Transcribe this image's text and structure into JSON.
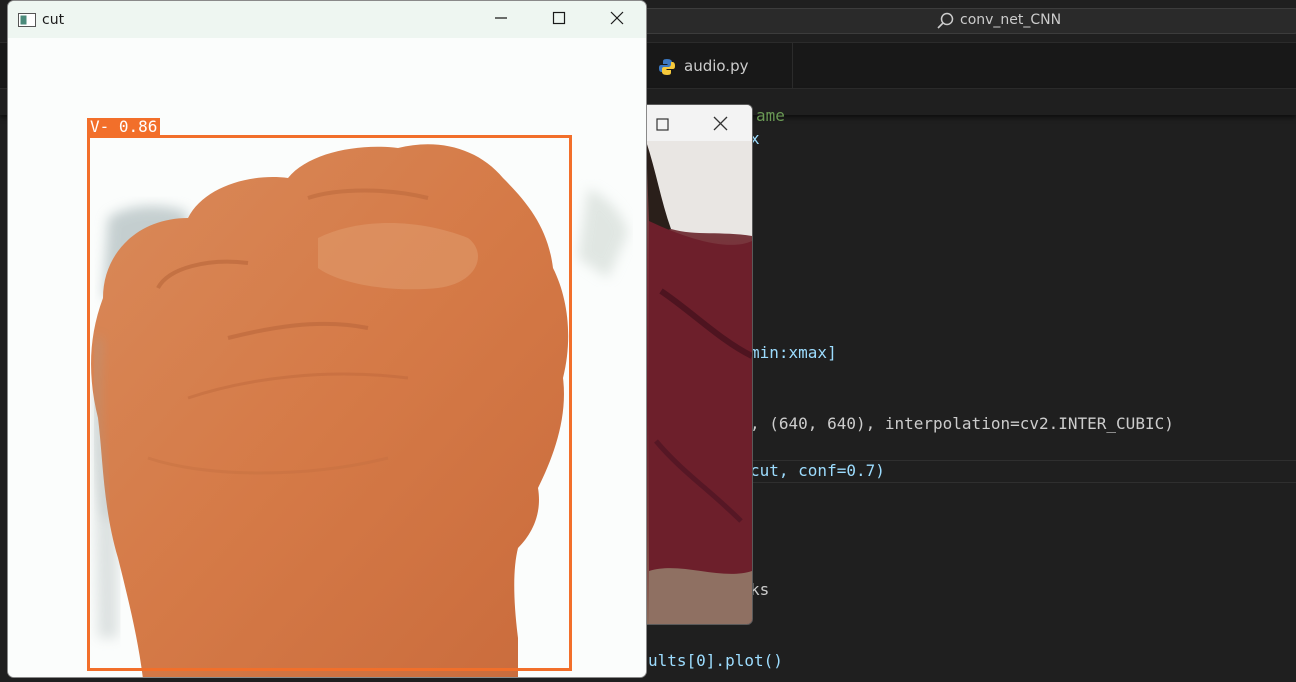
{
  "vscode": {
    "search_text": "conv_net_CNN",
    "tab_label": "audio.py",
    "code_lines": [
      {
        "text": "ame",
        "color": "#6a9955"
      },
      {
        "text": "x",
        "color": "#9cdcfe"
      },
      {
        "text": "min:xmax]",
        "color": "#9cdcfe"
      },
      {
        "text": ", (640, 640), interpolation=cv2.INTER_CUBIC)",
        "color": "#cccccc"
      },
      {
        "text": "cut, conf=0.7)",
        "color": "#9cdcfe"
      },
      {
        "text": "ks",
        "color": "#cccccc"
      },
      {
        "text": "ults[0].plot()",
        "color": "#9cdcfe"
      }
    ]
  },
  "cut_window": {
    "title": "cut",
    "detection_label": "V- 0.86",
    "detection_color": "#f26f2a"
  },
  "camera_window": {
    "title": ""
  },
  "icons": {
    "minimize": "minimize-icon",
    "maximize": "maximize-icon",
    "close": "close-icon",
    "search": "search-icon",
    "python": "python-file-icon"
  }
}
